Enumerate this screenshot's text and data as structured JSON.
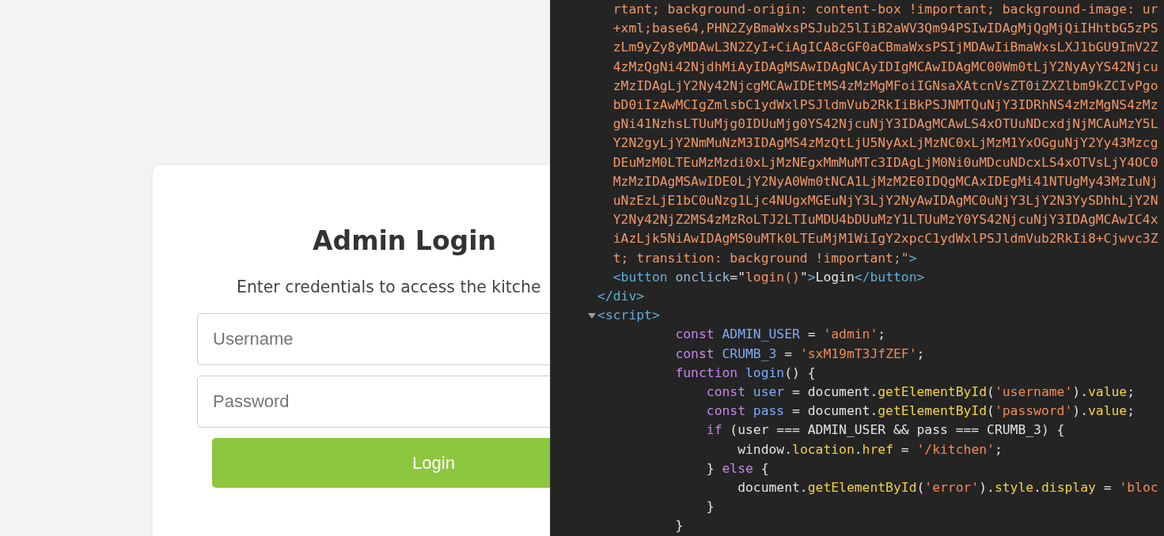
{
  "login": {
    "title": "Admin Login",
    "subtitle": "Enter credentials to access the kitche",
    "fields": [
      {
        "placeholder": "Username"
      },
      {
        "placeholder": "Password"
      }
    ],
    "button": "Login"
  },
  "devtools": {
    "lines": [
      {
        "kind": "text",
        "tokens": [
          {
            "kind": "value",
            "text": "        rtant; background-origin: content-box !important; background-image: ur"
          }
        ]
      },
      {
        "kind": "text",
        "tokens": [
          {
            "kind": "value",
            "text": "        +xml;base64,PHN2ZyBmaWxsPSJub25lIiB2aWV3Qm94PSIwIDAgMjQgMjQiIHhtbG5zPS"
          }
        ]
      },
      {
        "kind": "text",
        "tokens": [
          {
            "kind": "value",
            "text": "        zLm9yZy8yMDAwL3N2ZyI+CiAgICA8cGF0aCBmaWxsPSIjMDAwIiBmaWxsLXJ1bGU9ImV2Z"
          }
        ]
      },
      {
        "kind": "text",
        "tokens": [
          {
            "kind": "value",
            "text": "        4zMzQgNi42NjdhMiAyIDAgMSAwIDAgNCAyIDIgMCAwIDAgMC00Wm0tLjY2NyAyYS42Njcu"
          }
        ]
      },
      {
        "kind": "text",
        "tokens": [
          {
            "kind": "value",
            "text": "        zMzIDAgLjY2Ny42NjcgMCAwIDEtMS4zMzMgMFoiIGNsaXAtcnVsZT0iZXZlbm9kZCIvPgo"
          }
        ]
      },
      {
        "kind": "text",
        "tokens": [
          {
            "kind": "value",
            "text": "        bD0iIzAwMCIgZmlsbC1ydWxlPSJldmVub2RkIiBkPSJNMTQuNjY3IDRhNS4zMzMgNS4zMz"
          }
        ]
      },
      {
        "kind": "text",
        "tokens": [
          {
            "kind": "value",
            "text": "        gNi41NzhsLTUuMjg0IDUuMjg0YS42NjcuNjY3IDAgMCAwLS4xOTUuNDcxdjNjMCAuMzY5L"
          }
        ]
      },
      {
        "kind": "text",
        "tokens": [
          {
            "kind": "value",
            "text": "        Y2N2gyLjY2NmMuNzM3IDAgMS4zMzQtLjU5NyAxLjMzNC0xLjMzM1YxOGguNjY2Yy43Mzcg"
          }
        ]
      },
      {
        "kind": "text",
        "tokens": [
          {
            "kind": "value",
            "text": "        DEuMzM0LTEuMzMzdi0xLjMzNEgxMmMuMTc3IDAgLjM0Ni0uMDcuNDcxLS4xOTVsLjY4OC0"
          }
        ]
      },
      {
        "kind": "text",
        "tokens": [
          {
            "kind": "value",
            "text": "        MzMzIDAgMSAwIDE0LjY2NyA0Wm0tNCA1LjMzM2E0IDQgMCAxIDEgMi41NTUgMy43MzIuNj"
          }
        ]
      },
      {
        "kind": "text",
        "tokens": [
          {
            "kind": "value",
            "text": "        uNzEzLjE1bC0uNzg1Ljc4NUgxMGEuNjY3LjY2NyAwIDAgMC0uNjY3LjY2N3YySDhhLjY2N"
          }
        ]
      },
      {
        "kind": "text",
        "tokens": [
          {
            "kind": "value",
            "text": "        Y2Ny42NjZ2MS4zMzRoLTJ2LTIuMDU4bDUuMzY1LTUuMzY0YS42NjcuNjY3IDAgMCAwIC4x"
          }
        ]
      },
      {
        "kind": "text",
        "tokens": [
          {
            "kind": "value",
            "text": "        iAzLjk5NiAwIDAgMS0uMTk0LTEuMjM1WiIgY2xpcC1ydWxlPSJldmVub2RkIi8+Cjwvc3Z"
          }
        ]
      },
      {
        "kind": "text",
        "tokens": [
          {
            "kind": "value",
            "text": "        t; transition: background !important;\""
          },
          {
            "kind": "tag",
            "text": ">"
          }
        ]
      },
      {
        "kind": "text",
        "tokens": [
          {
            "kind": "tag",
            "text": "        <button"
          },
          {
            "kind": "attr",
            "text": " onclick"
          },
          {
            "kind": "plain",
            "text": "=\""
          },
          {
            "kind": "value",
            "text": "login()"
          },
          {
            "kind": "plain",
            "text": "\""
          },
          {
            "kind": "tag",
            "text": ">"
          },
          {
            "kind": "plain",
            "text": "Login"
          },
          {
            "kind": "tag",
            "text": "</button>"
          }
        ]
      },
      {
        "kind": "text",
        "tokens": [
          {
            "kind": "tag",
            "text": "      </div>"
          }
        ]
      },
      {
        "kind": "expandable",
        "expanded": true,
        "tokens": [
          {
            "kind": "tag",
            "text": "      <script>"
          }
        ]
      },
      {
        "kind": "text",
        "tokens": [
          {
            "kind": "keyword",
            "text": "                const"
          },
          {
            "kind": "variable",
            "text": " ADMIN_USER"
          },
          {
            "kind": "plain",
            "text": " = "
          },
          {
            "kind": "string",
            "text": "'admin'"
          },
          {
            "kind": "plain",
            "text": ";"
          }
        ]
      },
      {
        "kind": "text",
        "tokens": [
          {
            "kind": "keyword",
            "text": "                const"
          },
          {
            "kind": "variable",
            "text": " CRUMB_3"
          },
          {
            "kind": "plain",
            "text": " = "
          },
          {
            "kind": "string",
            "text": "'sxM19mT3JfZEF'"
          },
          {
            "kind": "plain",
            "text": ";"
          }
        ]
      },
      {
        "kind": "text",
        "tokens": [
          {
            "kind": "keyword",
            "text": "                function"
          },
          {
            "kind": "variable",
            "text": " login"
          },
          {
            "kind": "plain",
            "text": "() {"
          }
        ]
      },
      {
        "kind": "text",
        "tokens": [
          {
            "kind": "keyword",
            "text": "                    const"
          },
          {
            "kind": "variable",
            "text": " user"
          },
          {
            "kind": "plain",
            "text": " = document."
          },
          {
            "kind": "method",
            "text": "getElementById"
          },
          {
            "kind": "plain",
            "text": "("
          },
          {
            "kind": "string",
            "text": "'username'"
          },
          {
            "kind": "plain",
            "text": ")."
          },
          {
            "kind": "method",
            "text": "value"
          },
          {
            "kind": "plain",
            "text": ";"
          }
        ]
      },
      {
        "kind": "text",
        "tokens": [
          {
            "kind": "keyword",
            "text": "                    const"
          },
          {
            "kind": "variable",
            "text": " pass"
          },
          {
            "kind": "plain",
            "text": " = document."
          },
          {
            "kind": "method",
            "text": "getElementById"
          },
          {
            "kind": "plain",
            "text": "("
          },
          {
            "kind": "string",
            "text": "'password'"
          },
          {
            "kind": "plain",
            "text": ")."
          },
          {
            "kind": "method",
            "text": "value"
          },
          {
            "kind": "plain",
            "text": ";"
          }
        ]
      },
      {
        "kind": "text",
        "tokens": [
          {
            "kind": "keyword",
            "text": "                    if"
          },
          {
            "kind": "plain",
            "text": " (user === ADMIN_USER && pass === CRUMB_3) {"
          }
        ]
      },
      {
        "kind": "text",
        "tokens": [
          {
            "kind": "plain",
            "text": "                        window."
          },
          {
            "kind": "method",
            "text": "location"
          },
          {
            "kind": "plain",
            "text": "."
          },
          {
            "kind": "method",
            "text": "href"
          },
          {
            "kind": "plain",
            "text": " = "
          },
          {
            "kind": "string",
            "text": "'/kitchen'"
          },
          {
            "kind": "plain",
            "text": ";"
          }
        ]
      },
      {
        "kind": "text",
        "tokens": [
          {
            "kind": "plain",
            "text": "                    } "
          },
          {
            "kind": "keyword",
            "text": "else"
          },
          {
            "kind": "plain",
            "text": " {"
          }
        ]
      },
      {
        "kind": "text",
        "tokens": [
          {
            "kind": "plain",
            "text": "                        document."
          },
          {
            "kind": "method",
            "text": "getElementById"
          },
          {
            "kind": "plain",
            "text": "("
          },
          {
            "kind": "string",
            "text": "'error'"
          },
          {
            "kind": "plain",
            "text": ")."
          },
          {
            "kind": "method",
            "text": "style"
          },
          {
            "kind": "plain",
            "text": "."
          },
          {
            "kind": "method",
            "text": "display"
          },
          {
            "kind": "plain",
            "text": " = "
          },
          {
            "kind": "string",
            "text": "'bloc"
          }
        ]
      },
      {
        "kind": "text",
        "tokens": [
          {
            "kind": "plain",
            "text": "                    }"
          }
        ]
      },
      {
        "kind": "text",
        "tokens": [
          {
            "kind": "plain",
            "text": "                }"
          }
        ]
      }
    ]
  }
}
